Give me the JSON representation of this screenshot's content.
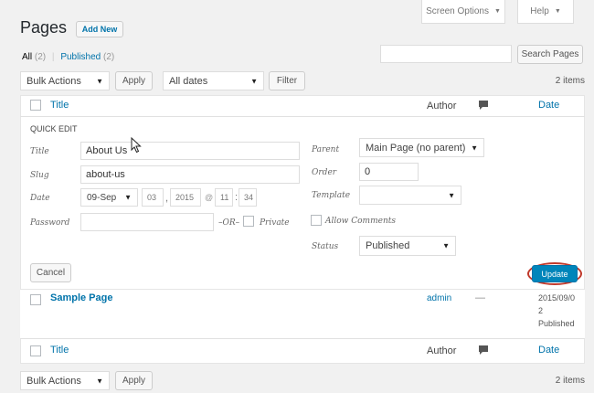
{
  "header": {
    "page_title": "Pages",
    "add_new": "Add New",
    "screen_options": "Screen Options",
    "help": "Help"
  },
  "subsubsub": {
    "all_label": "All",
    "all_count": "(2)",
    "separator": "|",
    "published_label": "Published",
    "published_count": "(2)"
  },
  "search": {
    "value": "",
    "button": "Search Pages"
  },
  "top_nav": {
    "bulk_actions": "Bulk Actions",
    "apply": "Apply",
    "dates": "All dates",
    "filter": "Filter",
    "items": "2 items"
  },
  "columns": {
    "title": "Title",
    "author": "Author",
    "date": "Date"
  },
  "quick_edit": {
    "heading": "QUICK EDIT",
    "title_label": "Title",
    "title_value": "About Us",
    "slug_label": "Slug",
    "slug_value": "about-us",
    "date_label": "Date",
    "month": "09-Sep",
    "day": "03",
    "comma": ",",
    "year": "2015",
    "at": "@",
    "hour": "11",
    "colon": ":",
    "minute": "34",
    "password_label": "Password",
    "password_value": "",
    "or_text": "–OR–",
    "private_label": "Private",
    "parent_label": "Parent",
    "parent_value": "Main Page (no parent)",
    "order_label": "Order",
    "order_value": "0",
    "template_label": "Template",
    "template_value": "",
    "allow_comments": "Allow Comments",
    "status_label": "Status",
    "status_value": "Published",
    "cancel": "Cancel",
    "update": "Update"
  },
  "rows": [
    {
      "title": "Sample Page",
      "author": "admin",
      "comments": "—",
      "date_line1": "2015/09/0",
      "date_line2": "2",
      "date_status": "Published"
    }
  ],
  "bottom_nav": {
    "bulk_actions": "Bulk Actions",
    "apply": "Apply",
    "items": "2 items"
  },
  "icons": {
    "comment": "comment-bubble-icon",
    "dropdown": "triangle-down-icon",
    "cursor": "mouse-cursor-icon"
  },
  "colors": {
    "link": "#0073aa",
    "primary": "#0085ba",
    "highlight_ring": "#c0392b",
    "background": "#f1f1f1"
  }
}
